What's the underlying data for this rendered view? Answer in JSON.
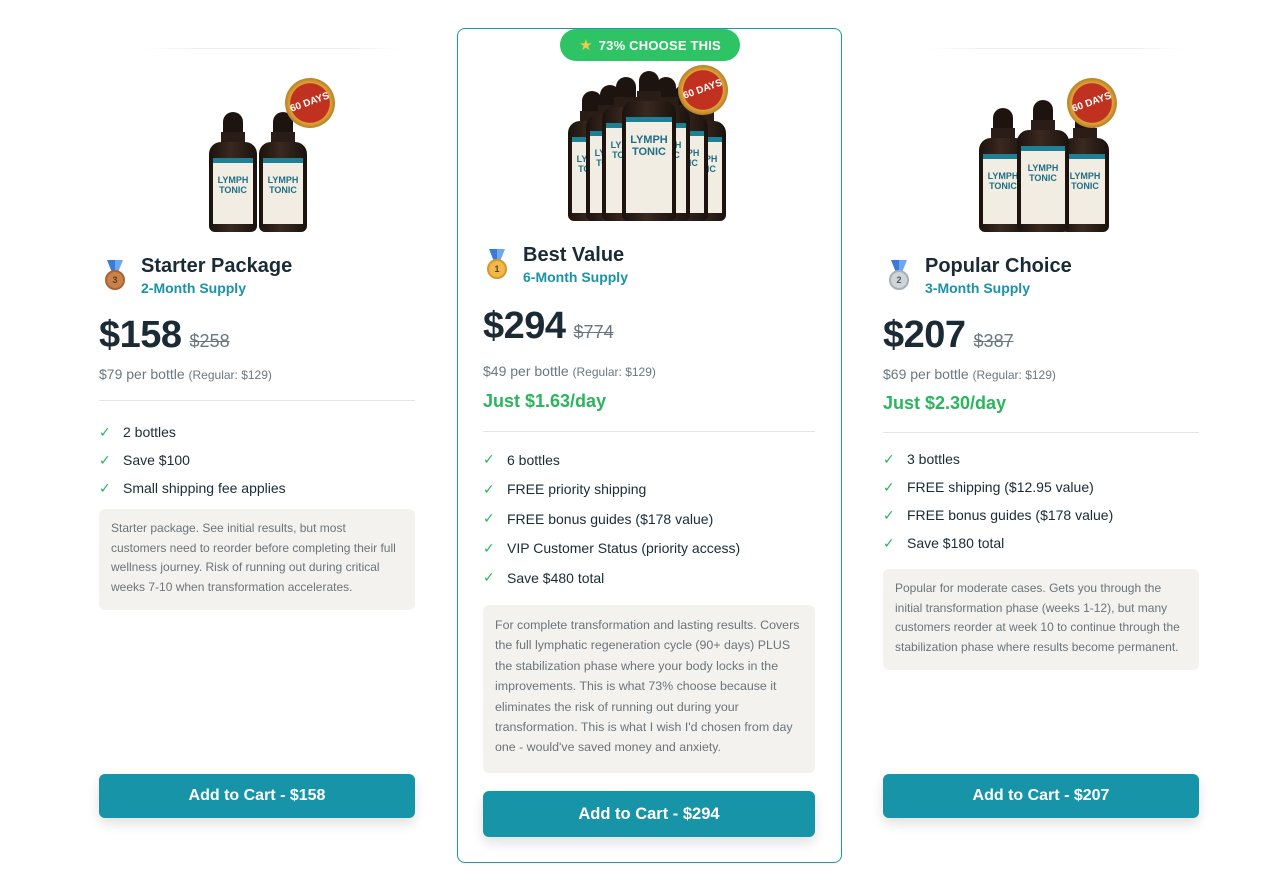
{
  "badge": {
    "icon": "star-icon",
    "text": "73% CHOOSE THIS"
  },
  "bottle_label": [
    "LYMPH",
    "TONIC"
  ],
  "seal_text": "60 DAYS",
  "cards": [
    {
      "medal": "3",
      "title": "Starter Package",
      "subtitle": "2-Month Supply",
      "price": "$158",
      "old_price": "$258",
      "per_bottle": "$79 per bottle",
      "regular": "(Regular: $129)",
      "daily": "",
      "features": [
        "2 bottles",
        "Save $100",
        "Small shipping fee applies"
      ],
      "note": "Starter package. See initial results, but most customers need to reorder before completing their full wellness journey. Risk of running out during critical weeks 7-10 when transformation accelerates.",
      "cta": "Add to Cart - $158"
    },
    {
      "medal": "1",
      "title": "Best Value",
      "subtitle": "6-Month Supply",
      "price": "$294",
      "old_price": "$774",
      "per_bottle": "$49 per bottle",
      "regular": "(Regular: $129)",
      "daily": "Just $1.63/day",
      "features": [
        "6 bottles",
        "FREE priority shipping",
        "FREE bonus guides ($178 value)",
        "VIP Customer Status (priority access)",
        "Save $480 total"
      ],
      "note": "For complete transformation and lasting results. Covers the full lymphatic regeneration cycle (90+ days) PLUS the stabilization phase where your body locks in the improvements. This is what 73% choose because it eliminates the risk of running out during your transformation. This is what I wish I'd chosen from day one - would've saved money and anxiety.",
      "cta": "Add to Cart - $294"
    },
    {
      "medal": "2",
      "title": "Popular Choice",
      "subtitle": "3-Month Supply",
      "price": "$207",
      "old_price": "$387",
      "per_bottle": "$69 per bottle",
      "regular": "(Regular: $129)",
      "daily": "Just $2.30/day",
      "features": [
        "3 bottles",
        "FREE shipping ($12.95 value)",
        "FREE bonus guides ($178 value)",
        "Save $180 total"
      ],
      "note": "Popular for moderate cases. Gets you through the initial transformation phase (weeks 1-12), but many customers reorder at week 10 to continue through the stabilization phase where results become permanent.",
      "cta": "Add to Cart - $207"
    }
  ]
}
